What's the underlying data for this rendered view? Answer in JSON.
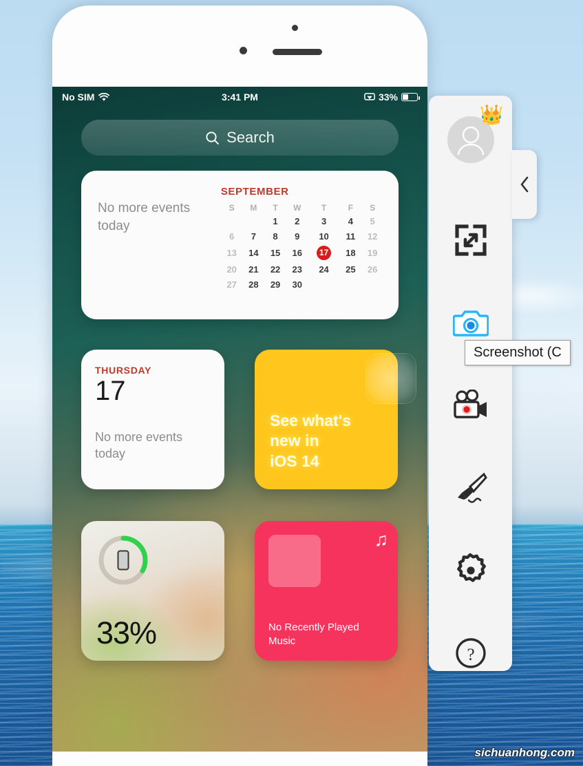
{
  "watermark": "sichuanhong.com",
  "phone": {
    "status_bar": {
      "carrier": "No SIM",
      "wifi_icon": "wifi-icon",
      "time": "3:41 PM",
      "mirroring_icon": "screen-mirroring-icon",
      "battery_percent": "33%",
      "battery_level": 33
    },
    "search": {
      "icon": "search-icon",
      "placeholder": "Search"
    },
    "widgets": {
      "calendar": {
        "empty_text": "No more events today",
        "month": "SEPTEMBER",
        "weekdays": [
          "S",
          "M",
          "T",
          "W",
          "T",
          "F",
          "S"
        ],
        "weeks": [
          [
            null,
            null,
            "1",
            "2",
            "3",
            "4",
            "5"
          ],
          [
            "6",
            "7",
            "8",
            "9",
            "10",
            "11",
            "12"
          ],
          [
            "13",
            "14",
            "15",
            "16",
            "17",
            "18",
            "19"
          ],
          [
            "20",
            "21",
            "22",
            "23",
            "24",
            "25",
            "26"
          ],
          [
            "27",
            "28",
            "29",
            "30",
            null,
            null,
            null
          ]
        ],
        "today": "17"
      },
      "up_next": {
        "weekday": "THURSDAY",
        "date": "17",
        "note": "No more events today"
      },
      "tips": {
        "line1": "See what's",
        "line2": "new in",
        "line3": "iOS 14",
        "background_color": "#ffc71d"
      },
      "battery": {
        "percent_label": "33%",
        "percent_value": 33,
        "device_icon": "iphone-icon",
        "ring_color": "#2fd24a"
      },
      "music": {
        "icon": "music-note-icon",
        "message": "No Recently Played Music",
        "background_color": "#f5335c"
      }
    }
  },
  "sidebar": {
    "avatar": {
      "icon": "user-avatar-icon",
      "badge": "crown-icon"
    },
    "collapse": {
      "icon": "chevron-left-icon"
    },
    "items": [
      {
        "name": "fullscreen",
        "icon": "fullscreen-expand-icon"
      },
      {
        "name": "screenshot",
        "icon": "camera-icon"
      },
      {
        "name": "record",
        "icon": "video-camera-icon"
      },
      {
        "name": "draw",
        "icon": "paint-brush-icon"
      },
      {
        "name": "settings",
        "icon": "gear-icon"
      },
      {
        "name": "help",
        "icon": "question-mark-icon"
      }
    ]
  },
  "tooltip": {
    "text": "Screenshot (C"
  }
}
